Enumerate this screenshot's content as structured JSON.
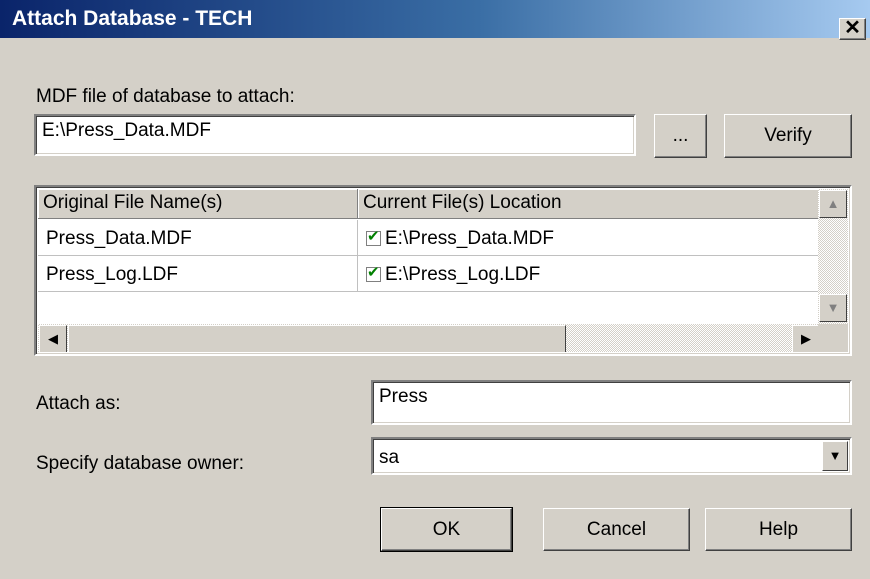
{
  "window": {
    "title": "Attach Database - TECH",
    "close_label": "✕"
  },
  "mdf": {
    "label": "MDF file of database to attach:",
    "value": "E:\\Press_Data.MDF",
    "browse_label": "...",
    "verify_label": "Verify"
  },
  "files_grid": {
    "columns": [
      "Original File Name(s)",
      "Current File(s) Location"
    ],
    "rows": [
      {
        "original": "Press_Data.MDF",
        "location": "E:\\Press_Data.MDF",
        "checked": true
      },
      {
        "original": "Press_Log.LDF",
        "location": "E:\\Press_Log.LDF",
        "checked": true
      }
    ]
  },
  "attach_as": {
    "label": "Attach as:",
    "value": "Press"
  },
  "owner": {
    "label": "Specify database owner:",
    "value": "sa"
  },
  "buttons": {
    "ok": "OK",
    "cancel": "Cancel",
    "help": "Help"
  },
  "colors": {
    "titlebar_start": "#0a246a",
    "titlebar_end": "#a6caf0",
    "face": "#d4d0c8",
    "check": "#008000"
  }
}
